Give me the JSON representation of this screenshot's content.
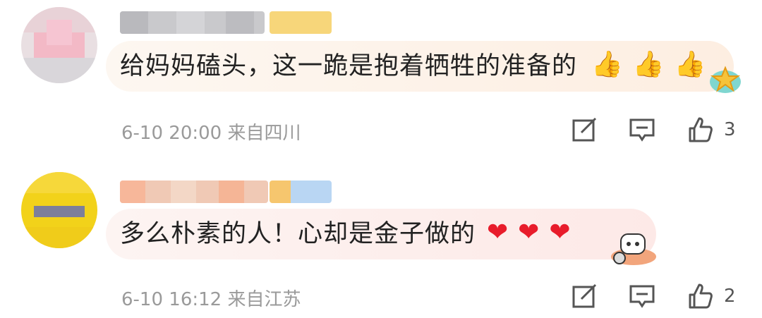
{
  "comments": [
    {
      "text": "给妈妈磕头，这一跪是抱着牺牲的准备的",
      "emojis": [
        "👍",
        "👍",
        "👍"
      ],
      "meta": "6-10 20:00 来自四川",
      "likes": "3"
    },
    {
      "text": "多么朴素的人！心却是金子做的",
      "emojis": [
        "❤",
        "❤",
        "❤"
      ],
      "meta": "6-10 16:12 来自江苏",
      "likes": "2"
    }
  ],
  "colors": {
    "comment_text": "#222222",
    "meta_text": "#9a9a9a",
    "heart": "#e81c2b",
    "thumb": "#e5a83a"
  },
  "icons": [
    "edit-icon",
    "reply-icon",
    "like-icon",
    "star-badge-sticker",
    "robot-sticker"
  ]
}
